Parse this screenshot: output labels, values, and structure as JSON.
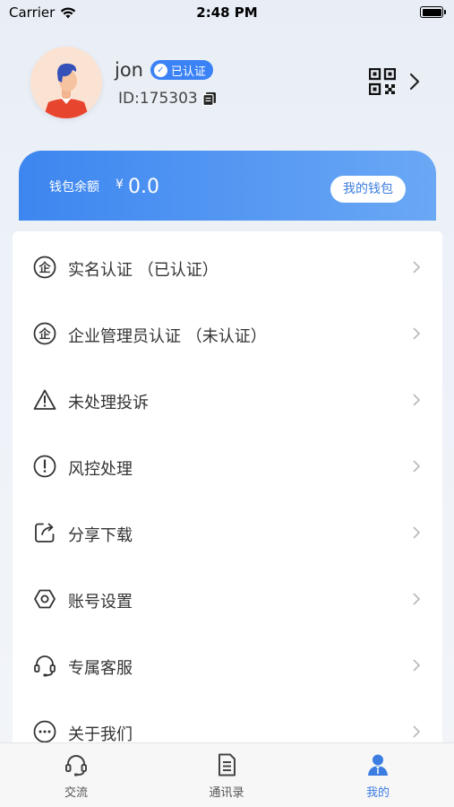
{
  "status_bar": {
    "carrier": "Carrier",
    "time": "2:48 PM"
  },
  "profile": {
    "username": "jon",
    "verified_label": "已认证",
    "user_id": "ID:175303"
  },
  "wallet": {
    "label": "钱包余额",
    "currency": "¥",
    "amount": "0.0",
    "button_label": "我的钱包"
  },
  "menu": [
    {
      "label": "实名认证 （已认证）",
      "icon": "enterprise-badge-icon"
    },
    {
      "label": "企业管理员认证 （未认证）",
      "icon": "enterprise-badge-icon"
    },
    {
      "label": "未处理投诉",
      "icon": "warning-triangle-icon"
    },
    {
      "label": "风控处理",
      "icon": "alert-circle-icon"
    },
    {
      "label": "分享下载",
      "icon": "share-icon"
    },
    {
      "label": "账号设置",
      "icon": "settings-hexagon-icon"
    },
    {
      "label": "专属客服",
      "icon": "headset-icon"
    },
    {
      "label": "关于我们",
      "icon": "more-circle-icon"
    }
  ],
  "tabbar": [
    {
      "label": "交流",
      "icon": "headset-icon",
      "active": false
    },
    {
      "label": "通讯录",
      "icon": "document-list-icon",
      "active": false
    },
    {
      "label": "我的",
      "icon": "person-icon",
      "active": true
    }
  ],
  "colors": {
    "accent": "#3b7de0",
    "wallet_start": "#3d86f0",
    "wallet_end": "#6aa8f5"
  }
}
